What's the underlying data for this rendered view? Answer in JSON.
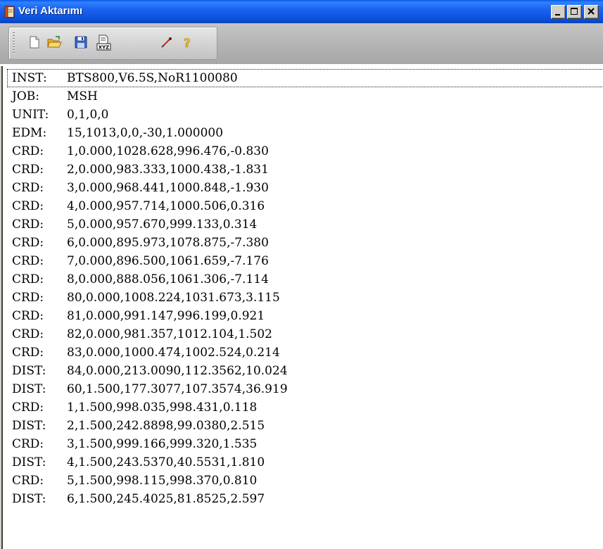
{
  "window": {
    "title": "Veri Aktarımı",
    "title_color": "#ffffff",
    "titlebar_color": "#0a4fd9"
  },
  "title_buttons": [
    {
      "name": "minimize-button",
      "icon": "minimize-icon"
    },
    {
      "name": "maximize-button",
      "icon": "maximize-icon"
    },
    {
      "name": "close-button",
      "icon": "close-icon"
    }
  ],
  "toolbar": {
    "buttons": [
      {
        "name": "new-button",
        "icon": "new-document-icon"
      },
      {
        "name": "open-button",
        "icon": "open-folder-icon"
      },
      {
        "name": "save-button",
        "icon": "floppy-disk-icon"
      },
      {
        "name": "export-xyz-button",
        "icon": "xyz-export-icon",
        "label": "XYZ"
      },
      {
        "name": "tool-button",
        "icon": "pin-tool-icon"
      },
      {
        "name": "help-button",
        "icon": "question-mark-icon",
        "label": "?"
      }
    ]
  },
  "lines": [
    {
      "code": "INST:",
      "value": "BTS800,V6.5S,NoR1100080"
    },
    {
      "code": "JOB:",
      "value": "MSH"
    },
    {
      "code": "UNIT:",
      "value": "0,1,0,0"
    },
    {
      "code": "EDM:",
      "value": "15,1013,0,0,-30,1.000000"
    },
    {
      "code": "CRD:",
      "value": "1,0.000,1028.628,996.476,-0.830"
    },
    {
      "code": "CRD:",
      "value": "2,0.000,983.333,1000.438,-1.831"
    },
    {
      "code": "CRD:",
      "value": "3,0.000,968.441,1000.848,-1.930"
    },
    {
      "code": "CRD:",
      "value": "4,0.000,957.714,1000.506,0.316"
    },
    {
      "code": "CRD:",
      "value": "5,0.000,957.670,999.133,0.314"
    },
    {
      "code": "CRD:",
      "value": "6,0.000,895.973,1078.875,-7.380"
    },
    {
      "code": "CRD:",
      "value": "7,0.000,896.500,1061.659,-7.176"
    },
    {
      "code": "CRD:",
      "value": "8,0.000,888.056,1061.306,-7.114"
    },
    {
      "code": "CRD:",
      "value": "80,0.000,1008.224,1031.673,3.115"
    },
    {
      "code": "CRD:",
      "value": "81,0.000,991.147,996.199,0.921"
    },
    {
      "code": "CRD:",
      "value": "82,0.000,981.357,1012.104,1.502"
    },
    {
      "code": "CRD:",
      "value": "83,0.000,1000.474,1002.524,0.214"
    },
    {
      "code": "DIST:",
      "value": "84,0.000,213.0090,112.3562,10.024"
    },
    {
      "code": "DIST:",
      "value": "60,1.500,177.3077,107.3574,36.919"
    },
    {
      "code": "CRD:",
      "value": "1,1.500,998.035,998.431,0.118"
    },
    {
      "code": "DIST:",
      "value": "2,1.500,242.8898,99.0380,2.515"
    },
    {
      "code": "CRD:",
      "value": "3,1.500,999.166,999.320,1.535"
    },
    {
      "code": "DIST:",
      "value": "4,1.500,243.5370,40.5531,1.810"
    },
    {
      "code": "CRD:",
      "value": "5,1.500,998.115,998.370,0.810"
    },
    {
      "code": "DIST:",
      "value": "6,1.500,245.4025,81.8525,2.597"
    }
  ]
}
